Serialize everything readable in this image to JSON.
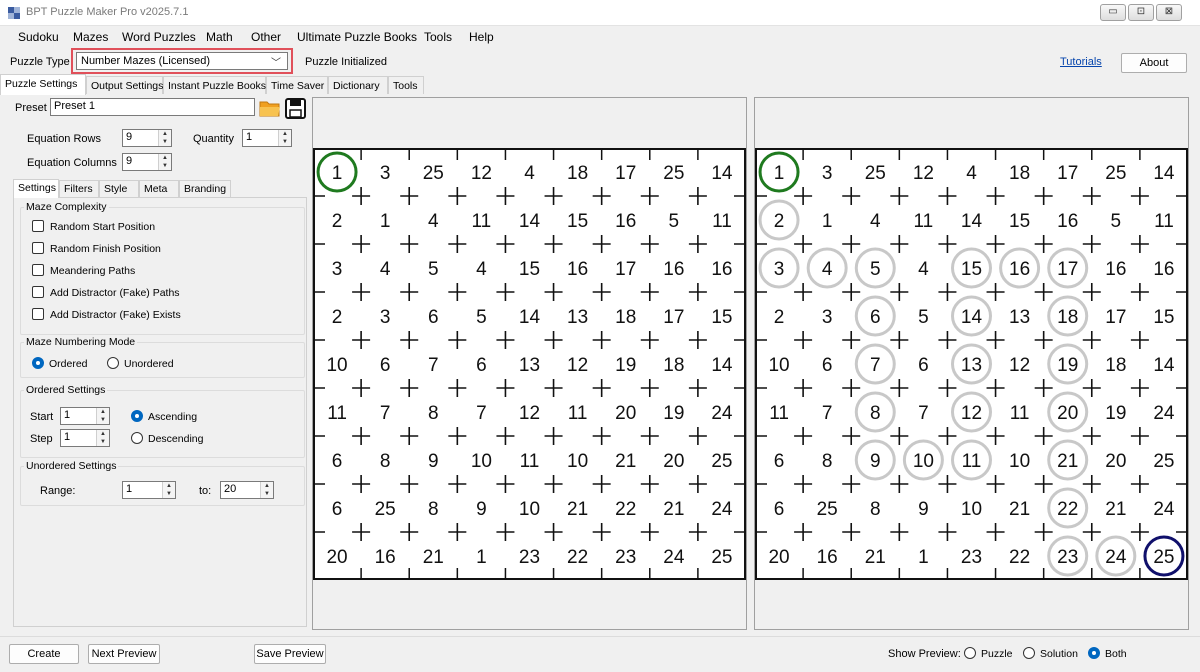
{
  "window": {
    "title": "BPT Puzzle Maker Pro v2025.7.1",
    "min": "▭",
    "max": "⊡",
    "close": "⊠"
  },
  "menu": [
    "Sudoku",
    "Mazes",
    "Word Puzzles",
    "Math",
    "Other",
    "Ultimate Puzzle Books",
    "Tools",
    "Help"
  ],
  "puzzle_type": {
    "label": "Puzzle Type",
    "value": "Number Mazes (Licensed)",
    "status": "Puzzle Initialized",
    "tutorials": "Tutorials",
    "about": "About"
  },
  "tabs": [
    "Puzzle Settings",
    "Output Settings",
    "Instant Puzzle Books",
    "Time Saver",
    "Dictionary",
    "Tools"
  ],
  "preset": {
    "label": "Preset",
    "value": "Preset 1"
  },
  "eq_rows": {
    "label": "Equation Rows",
    "value": "9"
  },
  "quantity": {
    "label": "Quantity",
    "value": "1"
  },
  "eq_cols": {
    "label": "Equation Columns",
    "value": "9"
  },
  "subtabs": [
    "Settings",
    "Filters",
    "Style",
    "Meta",
    "Branding"
  ],
  "maze_complexity": {
    "title": "Maze Complexity",
    "options": [
      "Random Start Position",
      "Random Finish Position",
      "Meandering Paths",
      "Add Distractor (Fake) Paths",
      "Add Distractor (Fake) Exists"
    ]
  },
  "numbering": {
    "title": "Maze Numbering Mode",
    "ordered": "Ordered",
    "unordered": "Unordered",
    "selected": "Ordered"
  },
  "ordered_settings": {
    "title": "Ordered Settings",
    "start_label": "Start",
    "start_value": "1",
    "step_label": "Step",
    "step_value": "1",
    "ascending": "Ascending",
    "descending": "Descending",
    "selected": "Ascending"
  },
  "unordered_settings": {
    "title": "Unordered Settings",
    "range_label": "Range:",
    "from_value": "1",
    "to_label": "to:",
    "to_value": "20"
  },
  "grid": [
    [
      1,
      3,
      25,
      12,
      4,
      18,
      17,
      25,
      14
    ],
    [
      2,
      1,
      4,
      11,
      14,
      15,
      16,
      5,
      11
    ],
    [
      3,
      4,
      5,
      4,
      15,
      16,
      17,
      16,
      16
    ],
    [
      2,
      3,
      6,
      5,
      14,
      13,
      18,
      17,
      15
    ],
    [
      10,
      6,
      7,
      6,
      13,
      12,
      19,
      18,
      14
    ],
    [
      11,
      7,
      8,
      7,
      12,
      11,
      20,
      19,
      24
    ],
    [
      6,
      8,
      9,
      10,
      11,
      10,
      21,
      20,
      25
    ],
    [
      6,
      25,
      8,
      9,
      10,
      21,
      22,
      21,
      24
    ],
    [
      20,
      16,
      21,
      1,
      23,
      22,
      23,
      24,
      25
    ]
  ],
  "solution_path": [
    [
      0,
      0
    ],
    [
      1,
      0
    ],
    [
      2,
      0
    ],
    [
      2,
      1
    ],
    [
      2,
      2
    ],
    [
      3,
      2
    ],
    [
      4,
      2
    ],
    [
      5,
      2
    ],
    [
      6,
      2
    ],
    [
      6,
      3
    ],
    [
      6,
      4
    ],
    [
      5,
      4
    ],
    [
      4,
      4
    ],
    [
      3,
      4
    ],
    [
      2,
      4
    ],
    [
      2,
      5
    ],
    [
      2,
      6
    ],
    [
      3,
      6
    ],
    [
      4,
      6
    ],
    [
      5,
      6
    ],
    [
      6,
      6
    ],
    [
      7,
      6
    ],
    [
      8,
      6
    ],
    [
      8,
      7
    ],
    [
      8,
      8
    ]
  ],
  "colors": {
    "start": "#1f7a1f",
    "finish": "#10106b",
    "path": "#c8c8c8",
    "highlight": "#e0505a",
    "accent": "#0067c0"
  },
  "bottom": {
    "create": "Create",
    "next": "Next Preview",
    "save": "Save Preview",
    "show_label": "Show Preview:",
    "puzzle": "Puzzle",
    "solution": "Solution",
    "both": "Both",
    "selected": "Both"
  }
}
